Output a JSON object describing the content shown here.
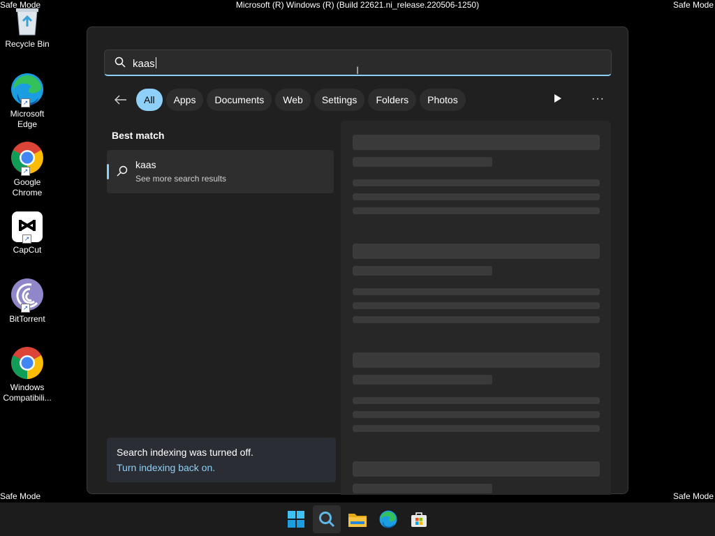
{
  "desktop": {
    "watermark": "Safe Mode",
    "build_text": "Microsoft (R) Windows (R) (Build 22621.ni_release.220506-1250)",
    "icons": [
      {
        "label": "Recycle Bin",
        "icon": "recycle-bin-icon"
      },
      {
        "label": "Microsoft Edge",
        "icon": "edge-icon"
      },
      {
        "label": "Google Chrome",
        "icon": "chrome-icon"
      },
      {
        "label": "CapCut",
        "icon": "capcut-icon"
      },
      {
        "label": "BitTorrent",
        "icon": "bittorrent-icon"
      },
      {
        "label": "Windows Compatibili...",
        "icon": "chrome-icon"
      }
    ]
  },
  "search": {
    "query": "kaas",
    "filters": [
      "All",
      "Apps",
      "Documents",
      "Web",
      "Settings",
      "Folders",
      "Photos"
    ],
    "active_filter": "All",
    "more_label": "···",
    "best_match_title": "Best match",
    "best_match": {
      "title": "kaas",
      "subtitle": "See more search results"
    },
    "notice": {
      "text": "Search indexing was turned off.",
      "link": "Turn indexing back on."
    }
  },
  "taskbar": {
    "items": [
      "start-icon",
      "search-icon",
      "file-explorer-icon",
      "edge-icon",
      "microsoft-store-icon"
    ],
    "active": "search-icon"
  },
  "colors": {
    "accent": "#8fd0f8",
    "panel": "#202020",
    "pill": "#2d2d2d"
  }
}
